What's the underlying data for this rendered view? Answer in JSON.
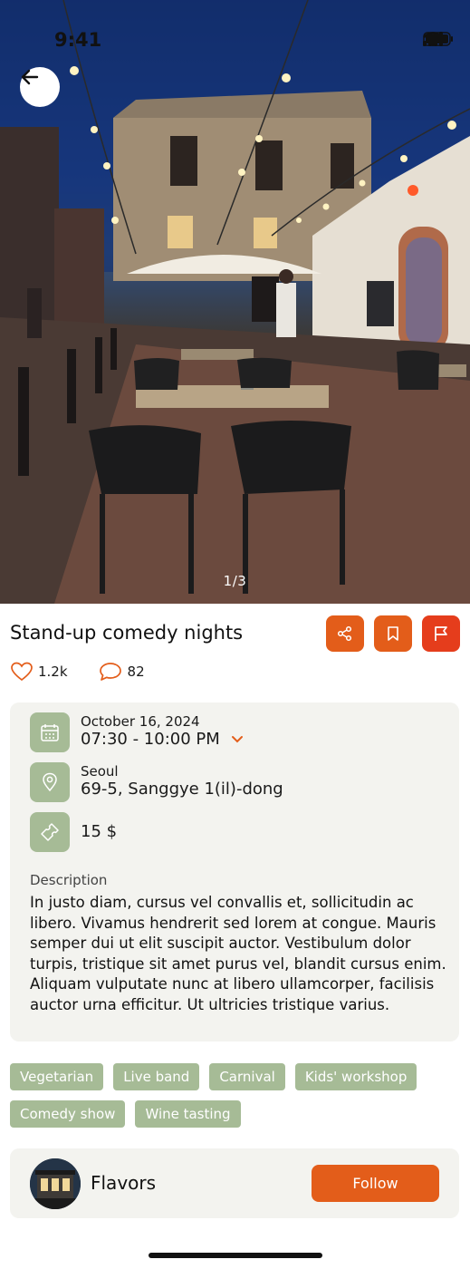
{
  "status_bar": {
    "time": "9:41"
  },
  "hero": {
    "pager": "1/3"
  },
  "event": {
    "title": "Stand-up comedy nights",
    "likes": "1.2k",
    "comments": "82",
    "date": "October 16, 2024",
    "time_range": "07:30 - 10:00 PM",
    "city": "Seoul",
    "address": "69-5, Sanggye 1(il)-dong",
    "price": "15 $",
    "description_label": "Description",
    "description": "In justo diam, cursus vel convallis et, sollicitudin ac libero. Vivamus hendrerit sed lorem at congue. Mauris semper dui ut elit suscipit auctor. Vestibulum dolor turpis, tristique sit amet purus vel, blandit cursus enim. Aliquam vulputate nunc at libero ullamcorper, facilisis auctor urna efficitur. Ut ultricies tristique varius."
  },
  "tags": [
    "Vegetarian",
    "Live band",
    "Carnival",
    "Kids' workshop",
    "Comedy show",
    "Wine tasting"
  ],
  "organizer": {
    "name": "Flavors",
    "follow_label": "Follow"
  },
  "colors": {
    "accent": "#e35d1a",
    "flag": "#e53d1c",
    "sage": "#a6bb96",
    "card": "#f3f3ef"
  }
}
